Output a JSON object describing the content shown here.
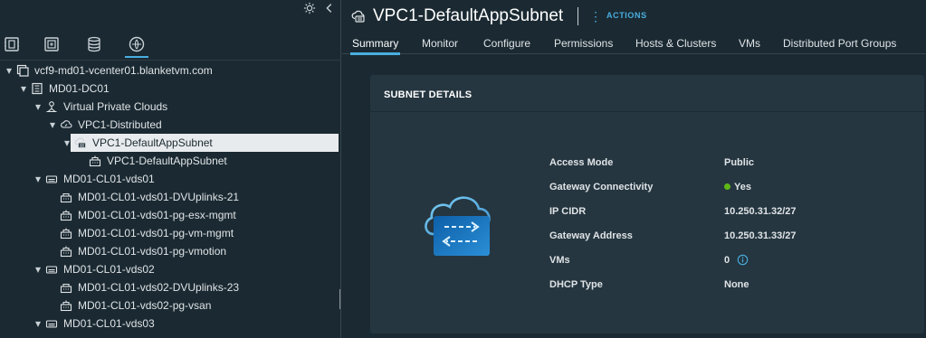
{
  "tree": {
    "tabs": [
      {
        "icon": "hosts-clusters-icon",
        "active": false
      },
      {
        "icon": "vms-templates-icon",
        "active": false
      },
      {
        "icon": "storage-icon",
        "active": false
      },
      {
        "icon": "networking-icon",
        "active": true
      }
    ],
    "nodes": [
      {
        "label": "vcf9-md01-vcenter01.blanketvm.com",
        "icon": "vcenter-icon",
        "expanded": true
      },
      {
        "label": "MD01-DC01",
        "icon": "datacenter-icon",
        "expanded": true
      },
      {
        "label": "Virtual Private Clouds",
        "icon": "vpc-folder-icon",
        "expanded": true
      },
      {
        "label": "VPC1-Distributed",
        "icon": "vpc-icon",
        "expanded": true
      },
      {
        "label": "VPC1-DefaultAppSubnet",
        "icon": "subnet-icon",
        "expanded": true,
        "selected": true
      },
      {
        "label": "VPC1-DefaultAppSubnet",
        "icon": "port-group-icon",
        "expanded": null
      },
      {
        "label": "MD01-CL01-vds01",
        "icon": "distributed-switch-icon",
        "expanded": true
      },
      {
        "label": "MD01-CL01-vds01-DVUplinks-21",
        "icon": "uplink-port-group-icon",
        "expanded": null
      },
      {
        "label": "MD01-CL01-vds01-pg-esx-mgmt",
        "icon": "port-group-icon",
        "expanded": null
      },
      {
        "label": "MD01-CL01-vds01-pg-vm-mgmt",
        "icon": "port-group-icon",
        "expanded": null
      },
      {
        "label": "MD01-CL01-vds01-pg-vmotion",
        "icon": "port-group-icon",
        "expanded": null
      },
      {
        "label": "MD01-CL01-vds02",
        "icon": "distributed-switch-icon",
        "expanded": true
      },
      {
        "label": "MD01-CL01-vds02-DVUplinks-23",
        "icon": "uplink-port-group-icon",
        "expanded": null
      },
      {
        "label": "MD01-CL01-vds02-pg-vsan",
        "icon": "port-group-icon",
        "expanded": null
      },
      {
        "label": "MD01-CL01-vds03",
        "icon": "distributed-switch-icon",
        "expanded": true
      }
    ]
  },
  "object": {
    "title": "VPC1-DefaultAppSubnet",
    "actions_label": "ACTIONS"
  },
  "tabs": [
    {
      "label": "Summary",
      "active": true
    },
    {
      "label": "Monitor",
      "active": false
    },
    {
      "label": "Configure",
      "active": false
    },
    {
      "label": "Permissions",
      "active": false
    },
    {
      "label": "Hosts & Clusters",
      "active": false
    },
    {
      "label": "VMs",
      "active": false
    },
    {
      "label": "Distributed Port Groups",
      "active": false
    }
  ],
  "subnet_details": {
    "header": "SUBNET DETAILS",
    "rows": [
      {
        "label": "Access Mode",
        "value": "Public"
      },
      {
        "label": "Gateway Connectivity",
        "value": "Yes",
        "status": "green"
      },
      {
        "label": "IP CIDR",
        "value": "10.250.31.32/27"
      },
      {
        "label": "Gateway Address",
        "value": "10.250.31.33/27"
      },
      {
        "label": "VMs",
        "value": "0",
        "info": true
      },
      {
        "label": "DHCP Type",
        "value": "None"
      }
    ]
  },
  "colors": {
    "background": "#1b2a32",
    "card": "#253640",
    "accent": "#49aee0",
    "status_green": "#5eb715",
    "selected_row": "#e8ebed"
  }
}
